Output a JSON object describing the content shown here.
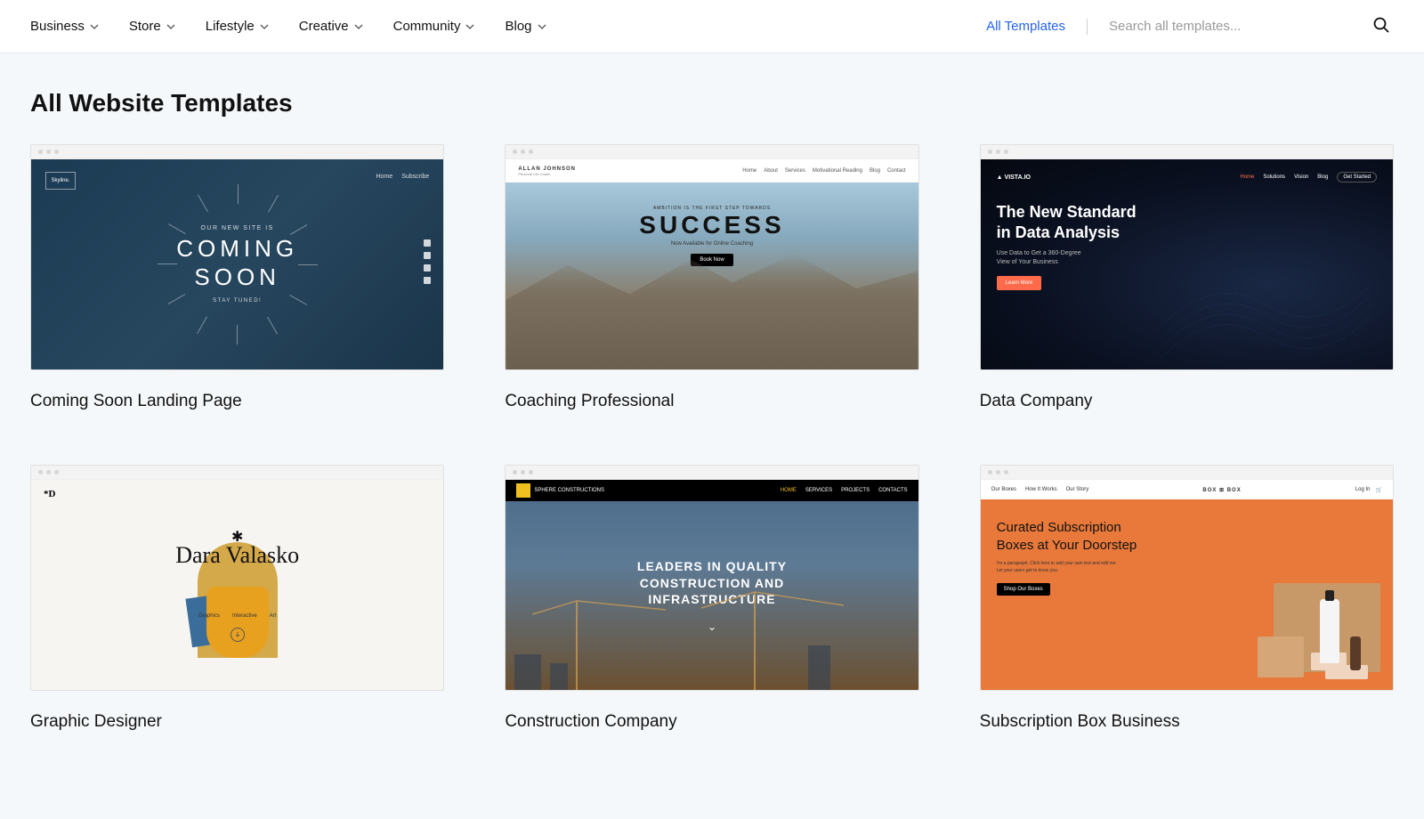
{
  "nav": {
    "categories": [
      "Business",
      "Store",
      "Lifestyle",
      "Creative",
      "Community",
      "Blog"
    ],
    "all_templates": "All Templates",
    "search_placeholder": "Search all templates..."
  },
  "page_title": "All Website Templates",
  "templates": [
    {
      "title": "Coming Soon Landing Page",
      "thumb": {
        "logo": "Skyline.",
        "nav": [
          "Home",
          "Subscribe"
        ],
        "pre": "OUR NEW SITE IS",
        "big_line1": "COMING",
        "big_line2": "SOON",
        "sub": "STAY TUNED!"
      }
    },
    {
      "title": "Coaching Professional",
      "thumb": {
        "brand": "ALLAN JOHNSON",
        "brand_sub": "Personal Life Coach",
        "nav": [
          "Home",
          "About",
          "Services",
          "Motivational Reading",
          "Blog",
          "Contact"
        ],
        "pre": "AMBITION IS THE FIRST STEP TOWARDS",
        "big": "SUCCESS",
        "sub": "Now Available for Online Coaching",
        "btn": "Book Now"
      }
    },
    {
      "title": "Data Company",
      "thumb": {
        "logo": "▲ VISTA.IO",
        "nav": [
          "Home",
          "Solutions",
          "Vision",
          "Blog"
        ],
        "cta": "Get Started",
        "head_line1": "The New Standard",
        "head_line2": "in Data Analysis",
        "sub_line1": "Use Data to Get a 360-Degree",
        "sub_line2": "View of Your Business",
        "btn": "Learn More"
      }
    },
    {
      "title": "Graphic Designer",
      "thumb": {
        "corner": "*D",
        "star": "✱",
        "name": "Dara Valasko",
        "cats": [
          "Graphics",
          "Interactive",
          "Art"
        ]
      }
    },
    {
      "title": "Construction Company",
      "thumb": {
        "brand": "SPHERE CONSTRUCTIONS",
        "nav": [
          "HOME",
          "SERVICES",
          "PROJECTS",
          "CONTACTS"
        ],
        "text_line1": "LEADERS IN QUALITY",
        "text_line2": "CONSTRUCTION AND",
        "text_line3": "INFRASTRUCTURE"
      }
    },
    {
      "title": "Subscription Box Business",
      "thumb": {
        "nav_left": [
          "Our Boxes",
          "How It Works",
          "Our Story"
        ],
        "logo": "BOX ⊞ BOX",
        "nav_right": [
          "Log In",
          "🛒"
        ],
        "head_line1": "Curated Subscription",
        "head_line2": "Boxes at Your Doorstep",
        "sub": "I'm a paragraph. Click here to add your own text and edit me. Let your users get to know you.",
        "btn": "Shop Our Boxes"
      }
    }
  ]
}
